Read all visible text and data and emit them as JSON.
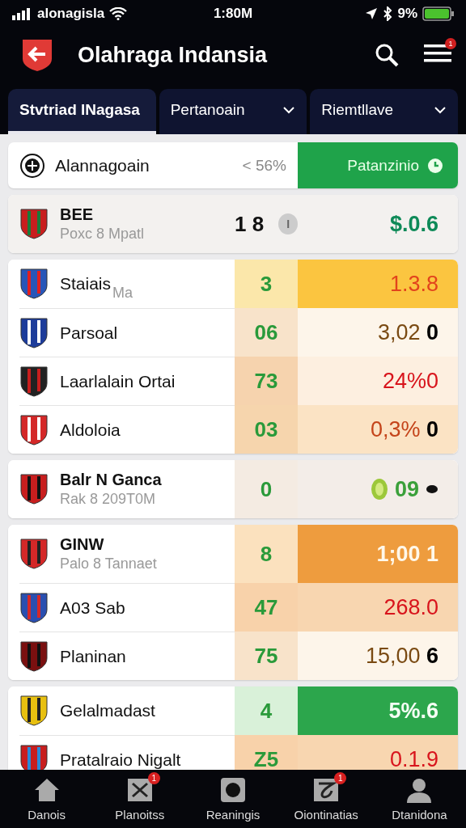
{
  "status_bar": {
    "carrier": "alonagisla",
    "time": "1:80M",
    "battery": "9%"
  },
  "header": {
    "title": "Olahraga Indansia",
    "menu_badge": "1"
  },
  "tabs": [
    {
      "label": "Stvtriad INagasa",
      "selected": true,
      "dropdown": false
    },
    {
      "label": "Pertanoain",
      "selected": false,
      "dropdown": true
    },
    {
      "label": "Riemtllave",
      "selected": false,
      "dropdown": true
    }
  ],
  "filter": {
    "label": "Alannagoain",
    "value": "< 56%",
    "button": "Patanzinio"
  },
  "cards": [
    {
      "rows": [
        {
          "name": "BEE",
          "bold": true,
          "subtitle": "Poxc 8 Mpatl",
          "score": "1 8",
          "marker": "I",
          "odds": "$.0.6",
          "kind": "summary"
        }
      ]
    },
    {
      "rows": [
        {
          "name": "Staiais",
          "bold": false,
          "subtitle": "Ma",
          "score": "3",
          "odds": "1.3.8",
          "kind": "gold"
        },
        {
          "name": "Parsoal",
          "bold": false,
          "score": "06",
          "odds": "3,02 **0**",
          "kind": "plain"
        },
        {
          "name": "Laarlalain Ortai",
          "bold": false,
          "score": "73",
          "odds": "24%0",
          "kind": "red"
        },
        {
          "name": "Aldoloia",
          "bold": false,
          "score": "03",
          "odds": "0,3% **0**",
          "kind": "peach"
        }
      ]
    },
    {
      "rows": [
        {
          "name": "Balr N Ganca",
          "bold": true,
          "subtitle": "Rak 8 209T0M",
          "score": "0",
          "odds": "09",
          "kind": "soft",
          "coin": true,
          "dot": true
        }
      ]
    },
    {
      "rows": [
        {
          "name": "GINW",
          "bold": true,
          "subtitle": "Palo 8 Tannaet",
          "score": "8",
          "odds": "1;00 1",
          "kind": "orange"
        },
        {
          "name": "A03 Sab",
          "bold": false,
          "score": "47",
          "odds": "268.0",
          "kind": "salmon"
        },
        {
          "name": "Planinan",
          "bold": false,
          "score": "75",
          "odds": "15,00 **6**",
          "kind": "plain"
        }
      ]
    },
    {
      "rows": [
        {
          "name": "Gelalmadast",
          "bold": false,
          "score": "4",
          "odds": "5%.6",
          "kind": "green"
        },
        {
          "name": "Pratalraio Nigalt",
          "bold": false,
          "score": "Z5",
          "odds": "0.1.9",
          "kind": "salmon"
        }
      ]
    }
  ],
  "nav": [
    {
      "label": "Danois"
    },
    {
      "label": "Planoitss",
      "badge": "1"
    },
    {
      "label": "Reaningis"
    },
    {
      "label": "Oiontinatias",
      "badge": "1"
    },
    {
      "label": "Dtanidona"
    }
  ]
}
